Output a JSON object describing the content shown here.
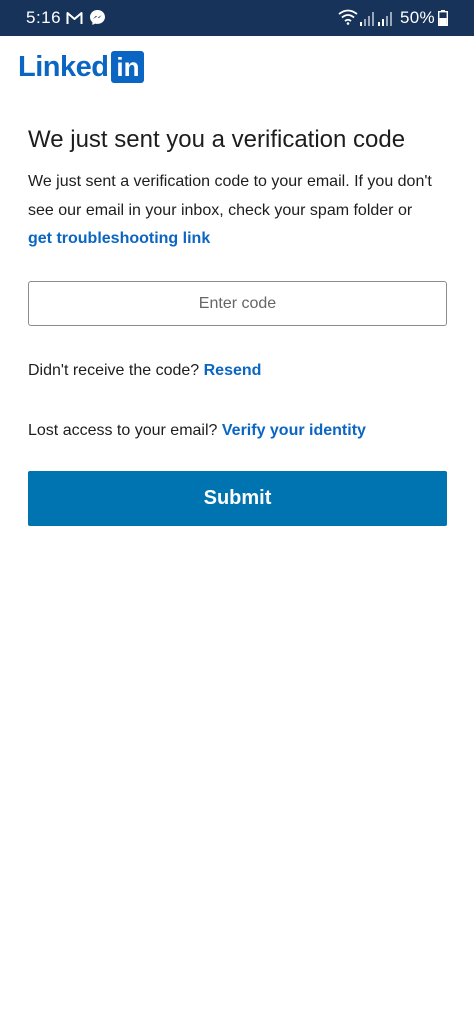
{
  "status_bar": {
    "time": "5:16",
    "battery": "50%",
    "notification_icons": [
      "gmail-icon",
      "messenger-icon"
    ],
    "system_icons": [
      "wifi-icon",
      "signal-icon",
      "signal-icon",
      "battery-icon"
    ]
  },
  "brand": {
    "logo_text": "Linked",
    "logo_box": "in",
    "color": "#0a66c2"
  },
  "page": {
    "title": "We just sent you a verification code",
    "description": "We just sent a verification code to your email. If you don't see our email in your inbox, check your spam folder or",
    "troubleshooting_link": "get troubleshooting link"
  },
  "form": {
    "code_placeholder": "Enter code",
    "code_value": ""
  },
  "resend": {
    "prompt": "Didn't receive the code?",
    "link": "Resend"
  },
  "verify": {
    "prompt": "Lost access to your email?",
    "link": "Verify your identity"
  },
  "submit": {
    "label": "Submit",
    "color": "#0073b1"
  }
}
